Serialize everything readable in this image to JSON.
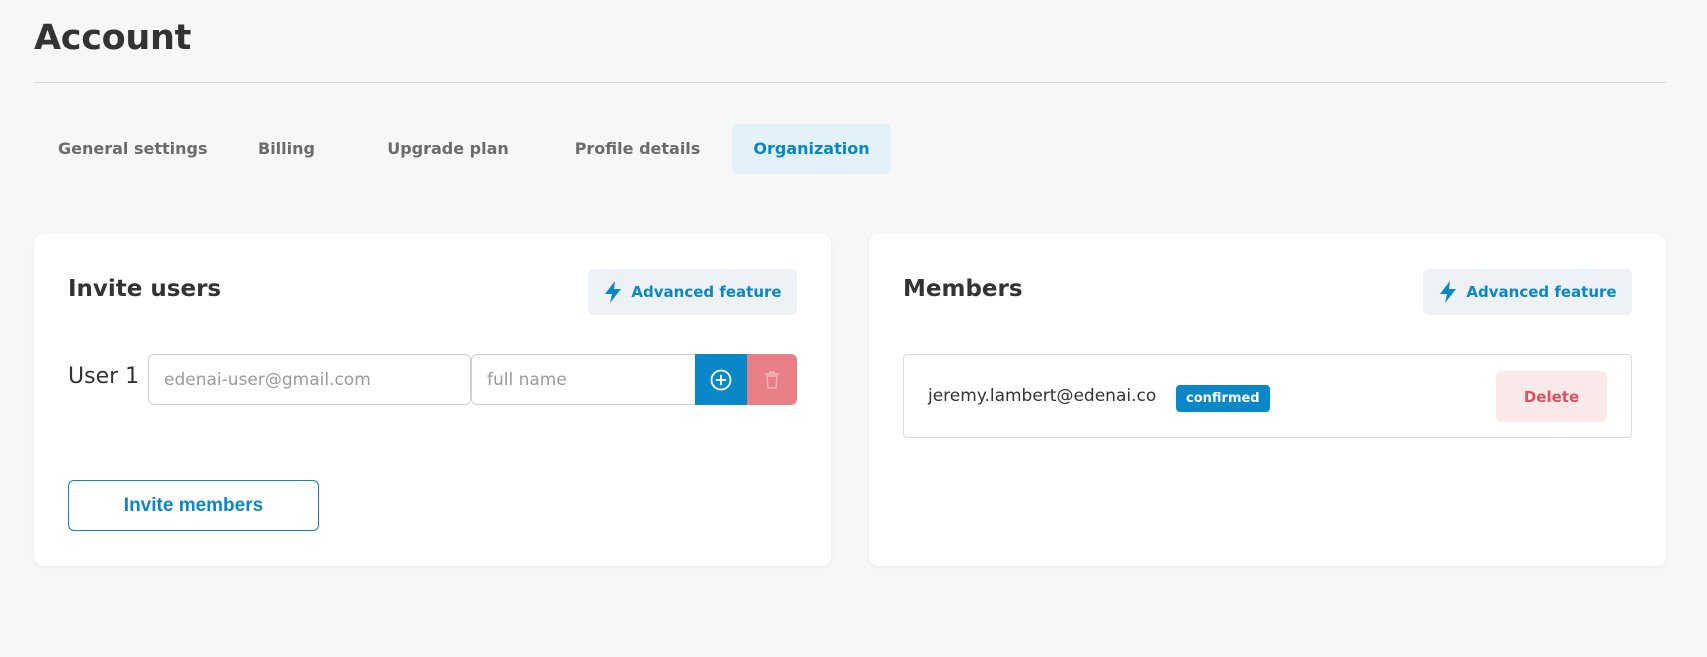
{
  "page": {
    "title": "Account"
  },
  "tabs": [
    {
      "label": "General settings",
      "active": false
    },
    {
      "label": "Billing",
      "active": false
    },
    {
      "label": "Upgrade plan",
      "active": false
    },
    {
      "label": "Profile details",
      "active": false
    },
    {
      "label": "Organization",
      "active": true
    }
  ],
  "invite_card": {
    "title": "Invite users",
    "advanced_label": "Advanced feature",
    "user_label": "User 1",
    "email_placeholder": "edenai-user@gmail.com",
    "name_placeholder": "full name",
    "invite_button": "Invite members"
  },
  "members_card": {
    "title": "Members",
    "advanced_label": "Advanced feature",
    "members": [
      {
        "email": "jeremy.lambert@edenai.co",
        "status": "confirmed",
        "delete_label": "Delete"
      }
    ]
  },
  "colors": {
    "accent": "#0a87c7",
    "danger": "#e87f86",
    "danger_text": "#d9545c",
    "active_tab_bg": "#e3f1f9"
  }
}
